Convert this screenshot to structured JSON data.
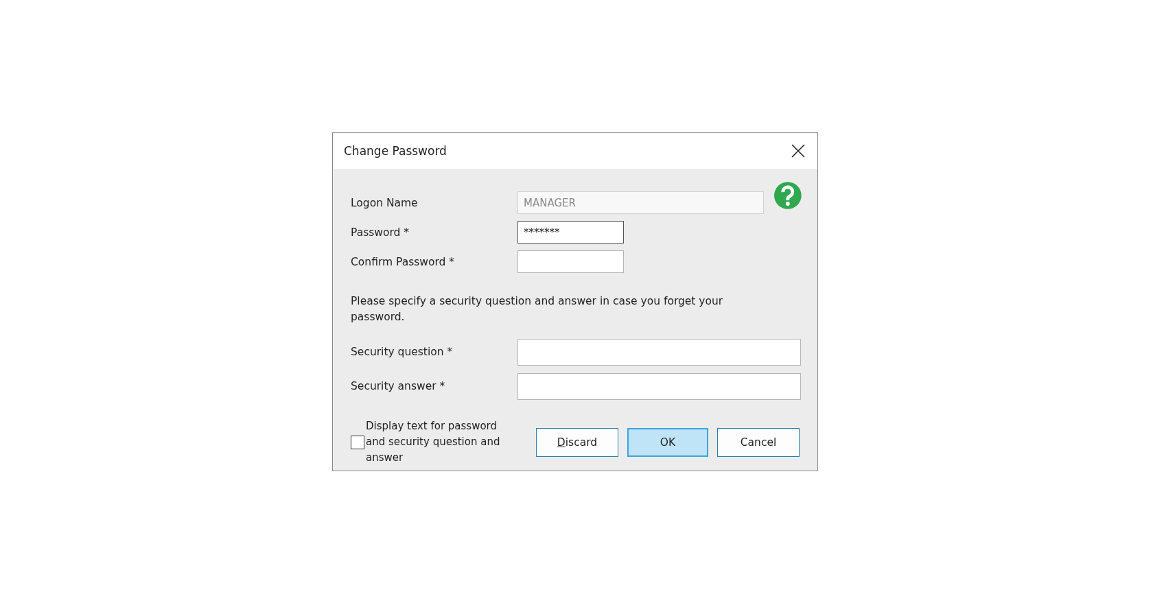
{
  "window": {
    "title": "Change Password"
  },
  "fields": [
    {
      "kind": "short",
      "label": "Logon Name",
      "value": "MANAGER",
      "disabled": true,
      "focused": false,
      "wide": true
    },
    {
      "kind": "short",
      "label": "Password *",
      "value": "*******",
      "disabled": false,
      "focused": true,
      "wide": false
    },
    {
      "kind": "short",
      "label": "Confirm Password *",
      "disabled": false,
      "focused": false,
      "wide": false
    }
  ],
  "instruction": "Please specify a security question and answer in case you forget your password.",
  "security_fields": [
    {
      "label": "Security question *"
    },
    {
      "label": "Security answer *"
    }
  ],
  "show_text_checkbox": {
    "label": "Display text for password and security question and answer",
    "checked": false
  },
  "buttons": [
    {
      "label": "Discard",
      "underline_first": true,
      "default": false
    },
    {
      "label": "OK",
      "underline_first": false,
      "default": true
    },
    {
      "label": "Cancel",
      "underline_first": false,
      "default": false
    }
  ]
}
